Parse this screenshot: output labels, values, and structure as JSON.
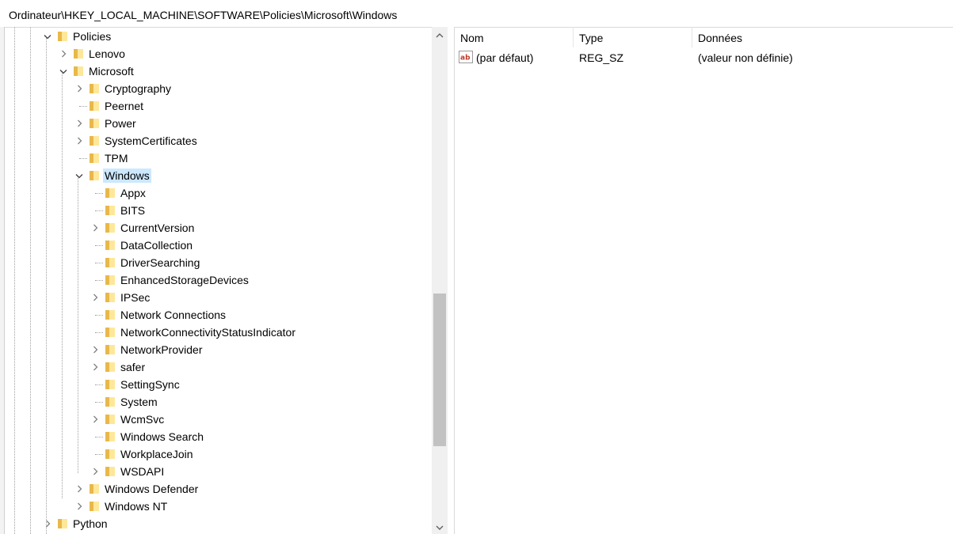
{
  "address_bar": {
    "path": "Ordinateur\\HKEY_LOCAL_MACHINE\\SOFTWARE\\Policies\\Microsoft\\Windows"
  },
  "tree": {
    "nodes": [
      {
        "label": "Policies",
        "expander": "expanded",
        "selected": false
      },
      {
        "label": "Lenovo",
        "expander": "collapsed",
        "selected": false
      },
      {
        "label": "Microsoft",
        "expander": "expanded",
        "selected": false
      },
      {
        "label": "Cryptography",
        "expander": "collapsed",
        "selected": false
      },
      {
        "label": "Peernet",
        "expander": "none",
        "selected": false
      },
      {
        "label": "Power",
        "expander": "collapsed",
        "selected": false
      },
      {
        "label": "SystemCertificates",
        "expander": "collapsed",
        "selected": false
      },
      {
        "label": "TPM",
        "expander": "none",
        "selected": false
      },
      {
        "label": "Windows",
        "expander": "expanded",
        "selected": true
      },
      {
        "label": "Appx",
        "expander": "none",
        "selected": false
      },
      {
        "label": "BITS",
        "expander": "none",
        "selected": false
      },
      {
        "label": "CurrentVersion",
        "expander": "collapsed",
        "selected": false
      },
      {
        "label": "DataCollection",
        "expander": "none",
        "selected": false
      },
      {
        "label": "DriverSearching",
        "expander": "none",
        "selected": false
      },
      {
        "label": "EnhancedStorageDevices",
        "expander": "none",
        "selected": false
      },
      {
        "label": "IPSec",
        "expander": "collapsed",
        "selected": false
      },
      {
        "label": "Network Connections",
        "expander": "none",
        "selected": false
      },
      {
        "label": "NetworkConnectivityStatusIndicator",
        "expander": "none",
        "selected": false
      },
      {
        "label": "NetworkProvider",
        "expander": "collapsed",
        "selected": false
      },
      {
        "label": "safer",
        "expander": "collapsed",
        "selected": false
      },
      {
        "label": "SettingSync",
        "expander": "none",
        "selected": false
      },
      {
        "label": "System",
        "expander": "none",
        "selected": false
      },
      {
        "label": "WcmSvc",
        "expander": "collapsed",
        "selected": false
      },
      {
        "label": "Windows Search",
        "expander": "none",
        "selected": false
      },
      {
        "label": "WorkplaceJoin",
        "expander": "none",
        "selected": false
      },
      {
        "label": "WSDAPI",
        "expander": "collapsed",
        "selected": false
      },
      {
        "label": "Windows Defender",
        "expander": "collapsed",
        "selected": false
      },
      {
        "label": "Windows NT",
        "expander": "collapsed",
        "selected": false
      },
      {
        "label": "Python",
        "expander": "collapsed",
        "selected": false
      }
    ]
  },
  "values_list": {
    "columns": [
      "Nom",
      "Type",
      "Données"
    ],
    "rows": [
      {
        "name": "(par défaut)",
        "type": "REG_SZ",
        "data": "(valeur non définie)",
        "icon": "string-value-icon"
      }
    ]
  },
  "colors": {
    "selection": "#cce8ff",
    "folder_light": "#ffe79a",
    "folder_dark": "#e8b84a",
    "scroll_thumb": "#c2c2c2"
  }
}
